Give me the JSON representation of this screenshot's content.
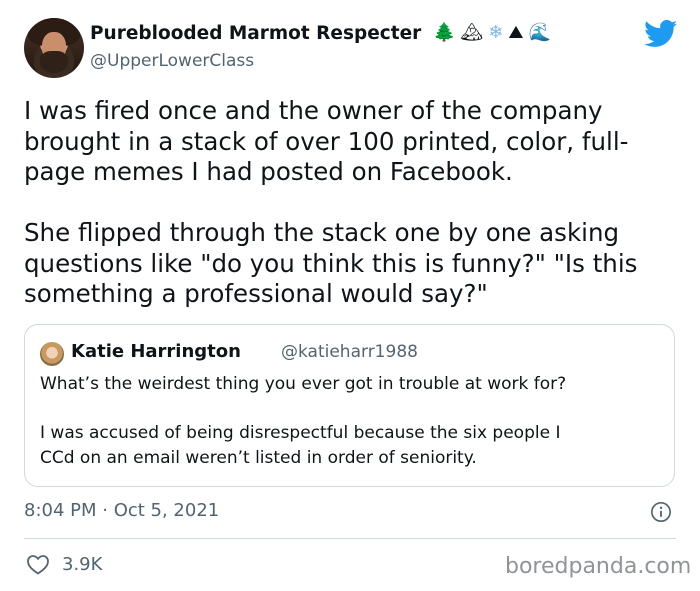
{
  "author": {
    "display_name": "Pureblooded Marmot Respecter",
    "name_emojis": [
      "🌲",
      "🏔",
      "❄",
      "⛰",
      "🌊"
    ],
    "handle": "@UpperLowerClass",
    "avatar_icon": "avatar-photo"
  },
  "tweet": {
    "text": "I was fired once and the owner of the company\nbrought in a stack of over 100 printed, color, full-\npage memes I had posted on Facebook.\n\nShe flipped through the stack one by one asking\nquestions like \"do you think this is funny?\" \"Is this\nsomething a professional would say?\"",
    "timestamp": "8:04 PM · Oct 5, 2021"
  },
  "quoted_tweet": {
    "display_name": "Katie Harrington",
    "handle": "@katieharr1988",
    "text": "What’s the weirdest thing you ever got in trouble at work for?\n\nI was accused of being disrespectful because the six people I\nCCd on an email weren’t listed in order of seniority."
  },
  "engagement": {
    "likes": "3.9K"
  },
  "watermark": "boredpanda.com",
  "colors": {
    "twitter_blue": "#1d9bf0",
    "secondary_text": "#536471",
    "border": "#cfd9de"
  }
}
